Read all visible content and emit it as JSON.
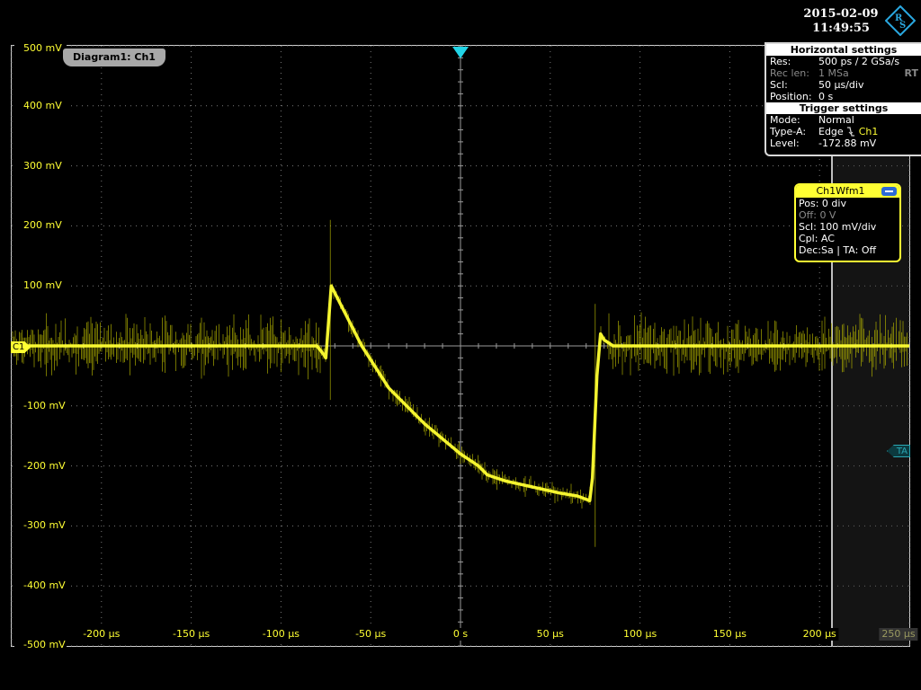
{
  "header": {
    "date": "2015-02-09",
    "time": "11:49:55"
  },
  "logo_icon": "rohde-schwarz-logo",
  "diagram": {
    "tab_label": "Diagram1: Ch1",
    "channel_marker": "C1",
    "trigger_offset_marker": "TA"
  },
  "horizontal_settings": {
    "title": "Horizontal settings",
    "rows": [
      {
        "key": "Res:",
        "value": "500 ps / 2 GSa/s"
      },
      {
        "key": "Rec len:",
        "value": "1 MSa"
      },
      {
        "key": "Scl:",
        "value": "50 µs/div"
      },
      {
        "key": "Position:",
        "value": "0 s"
      }
    ],
    "mode_badge": "RT"
  },
  "trigger_settings": {
    "title": "Trigger settings",
    "mode_key": "Mode:",
    "mode_value": "Normal",
    "type_key": "Type-A:",
    "type_value": "Edge",
    "type_source": "Ch1",
    "level_key": "Level:",
    "level_value": "-172.88 mV"
  },
  "waveform_box": {
    "title": "Ch1Wfm1",
    "rows": [
      "Pos: 0 div",
      "Off: 0 V",
      "Scl: 100 mV/div",
      "Cpl: AC",
      "Dec:Sa | TA: Off"
    ]
  },
  "colors": {
    "trace": "#ffff33",
    "trigger": "#22d4e6",
    "grid": "#7a7a7a",
    "background": "#000000"
  },
  "chart_data": {
    "type": "line",
    "title": "",
    "xlabel": "",
    "ylabel": "",
    "x_unit": "µs",
    "y_unit": "mV",
    "xlim": [
      -250,
      250
    ],
    "ylim": [
      -500,
      500
    ],
    "grid": true,
    "x_ticks": [
      "-200 µs",
      "-150 µs",
      "-100 µs",
      "-50 µs",
      "0 s",
      "50 µs",
      "100 µs",
      "150 µs",
      "200 µs",
      "250 µs"
    ],
    "y_ticks": [
      "500 mV",
      "400 mV",
      "300 mV",
      "200 mV",
      "100 mV",
      "-100 mV",
      "-200 mV",
      "-300 mV",
      "-400 mV",
      "-500 mV"
    ],
    "series": [
      {
        "x": [
          -250,
          -80,
          -76,
          -75,
          -72,
          -55,
          -40,
          -20,
          0,
          10,
          15,
          20,
          25,
          40,
          55,
          65,
          72,
          73.5,
          76,
          78,
          80,
          85,
          90,
          250
        ],
        "y": [
          0,
          0,
          -15,
          -20,
          100,
          0,
          -70,
          -130,
          -180,
          -200,
          -215,
          -220,
          -225,
          -235,
          -245,
          -250,
          -258,
          -220,
          -50,
          20,
          10,
          0,
          0,
          0
        ]
      }
    ]
  }
}
